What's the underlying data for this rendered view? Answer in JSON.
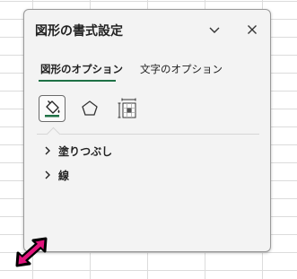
{
  "pane": {
    "title": "図形の書式設定",
    "collapse_icon": "chevron-down-icon",
    "close_icon": "close-icon"
  },
  "tabs": [
    {
      "label": "図形のオプション",
      "active": true
    },
    {
      "label": "文字のオプション",
      "active": false
    }
  ],
  "category_icons": [
    {
      "name": "fill-line-icon",
      "selected": true
    },
    {
      "name": "effects-pentagon-icon",
      "selected": false
    },
    {
      "name": "size-properties-icon",
      "selected": false
    }
  ],
  "sections": [
    {
      "label": "塗りつぶし",
      "expanded": false
    },
    {
      "label": "線",
      "expanded": false
    }
  ],
  "colors": {
    "accent_green": "#1e7145",
    "resize_cursor": "#e0147c"
  }
}
